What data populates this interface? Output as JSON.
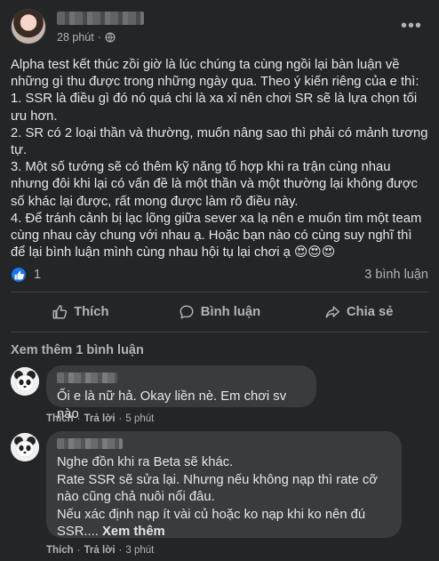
{
  "post": {
    "time": "28 phút",
    "separator": "·",
    "body": "Alpha test kết thúc zồi giờ là lúc chúng ta cùng ngồi lại bàn luận về\nnhững gì thu được trong những ngày qua. Theo ý kiến riêng của e thì:\n1. SSR là điều gì đó nó quá chi là xa xỉ nên chơi SR sẽ là lựa chọn tối\nưu hơn.\n2. SR có 2 loại thần và thường, muốn nâng sao thì phải có mảnh tương\ntự.\n3. Một số tướng sẽ có thêm kỹ năng tổ hợp khi ra trận cùng nhau\nnhưng đôi khi lại có vấn đề là một thần và một thường lại không được\nsố khác lại được, rất mong được làm rõ điều này.\n4. Để tránh cảnh bị lạc lõng giữa sever xa lạ nên e muốn tìm một team\ncùng nhau cày chung với nhau ạ. Hoặc bạn nào có cùng suy nghĩ thì\nđể lại bình luận mình cùng nhau hội tụ lại chơi ạ 😍😍😍"
  },
  "reactions": {
    "count": "1",
    "comments": "3 bình luận"
  },
  "actions": {
    "like": "Thích",
    "comment": "Bình luận",
    "share": "Chia sẻ"
  },
  "more_comments": "Xem thêm 1 bình luận",
  "comments": [
    {
      "text": "Ối e là nữ hả. Okay liền nè. Em chơi sv nào",
      "like": "Thích",
      "reply": "Trả lời",
      "dot": "·",
      "time": "5 phút"
    },
    {
      "text": "Nghe đồn khi ra Beta sẽ khác.\nRate SSR sẽ sửa lại. Nhưng nếu không nạp thì rate cỡ\nnào cũng chả nuôi nổi đâu.\nNếu xác định nạp ít vài củ hoặc ko nạp khi ko nên đú\nSSR.... ",
      "see_more": "Xem thêm",
      "like": "Thích",
      "reply": "Trả lời",
      "dot": "·",
      "time": "3 phút"
    }
  ],
  "colors": {
    "background": "#242526",
    "bubble": "#3a3b3c",
    "text": "#e4e6eb",
    "secondary_text": "#b0b3b8",
    "like_blue": "#1877f2"
  },
  "icons": [
    "globe-icon",
    "more-icon",
    "like-icon",
    "comment-icon",
    "share-icon"
  ]
}
